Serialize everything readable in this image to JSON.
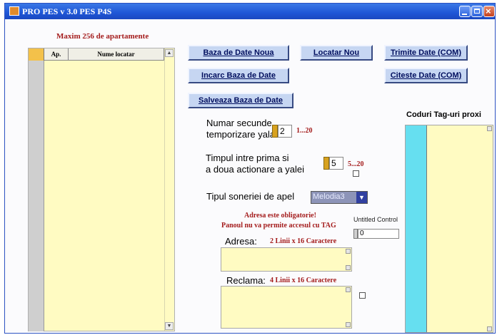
{
  "window": {
    "title": "PRO PES v 3.0 PES P4S"
  },
  "list": {
    "caption": "Maxim 256 de apartamente",
    "col_ap": "Ap.",
    "col_name": "Nume locatar"
  },
  "buttons": {
    "baza_noua": "Baza de Date Noua",
    "locatar_nou": "Locatar Nou",
    "trimite": "Trimite Date (COM)",
    "incarc": "Incarc Baza de Date",
    "citeste": "Citeste Date (COM)",
    "salveaza": "Salveaza Baza de Date"
  },
  "settings": {
    "temporizare_line1": "Numar secunde",
    "temporizare_line2": "temporizare yala",
    "temporizare_value": "2",
    "temporizare_range": "1...20",
    "timpul_line1": "Timpul intre prima si",
    "timpul_line2": "a doua actionare a yalei",
    "timpul_value": "5",
    "timpul_range": "5...20",
    "sonerie_label": "Tipul soneriei de apel",
    "sonerie_value": "Melodia3"
  },
  "notes": {
    "line1": "Adresa este obligatorie!",
    "line2": "Panoul nu va permite accesul cu TAG"
  },
  "untitled": {
    "label": "Untitled Control",
    "value": "0"
  },
  "adresa": {
    "label": "Adresa:",
    "hint": "2 Linii x 16 Caractere"
  },
  "reclama": {
    "label": "Reclama:",
    "hint": "4 Linii x 16 Caractere"
  },
  "proxi": {
    "title": "Coduri Tag-uri proxi"
  },
  "colors": {
    "titlebar": "#245edb",
    "field_bg": "#fffbc2",
    "accent_red": "#a41c1c",
    "proxi_side": "#66dff0"
  }
}
